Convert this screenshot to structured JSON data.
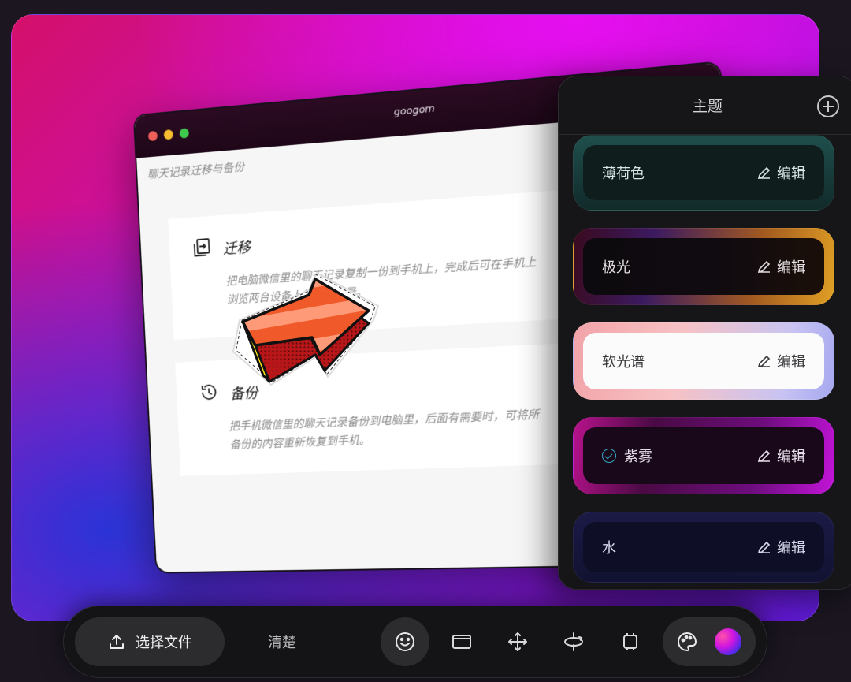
{
  "mock_window": {
    "title": "googom",
    "subtitle": "聊天记录迁移与备份",
    "cards": [
      {
        "title": "迁移",
        "desc": "把电脑微信里的聊天记录复制一份到手机上，完成后可在手机上浏览两台设备上的聊天记录。"
      },
      {
        "title": "备份",
        "desc": "把手机微信里的聊天记录备份到电脑里，后面有需要时，可将所备份的内容重新恢复到手机。"
      }
    ]
  },
  "theme_panel": {
    "title": "主题",
    "edit_label": "编辑",
    "themes": [
      {
        "name": "薄荷色",
        "selected": false
      },
      {
        "name": "极光",
        "selected": false
      },
      {
        "name": "软光谱",
        "selected": false
      },
      {
        "name": "紫雾",
        "selected": true
      },
      {
        "name": "水",
        "selected": false
      }
    ]
  },
  "toolbar": {
    "choose_file": "选择文件",
    "clear": "清楚",
    "tools": [
      "emoji-icon",
      "frame-icon",
      "move-icon",
      "rotate-icon",
      "crop-icon",
      "palette-icon"
    ],
    "accent_color": "#c214d8"
  }
}
